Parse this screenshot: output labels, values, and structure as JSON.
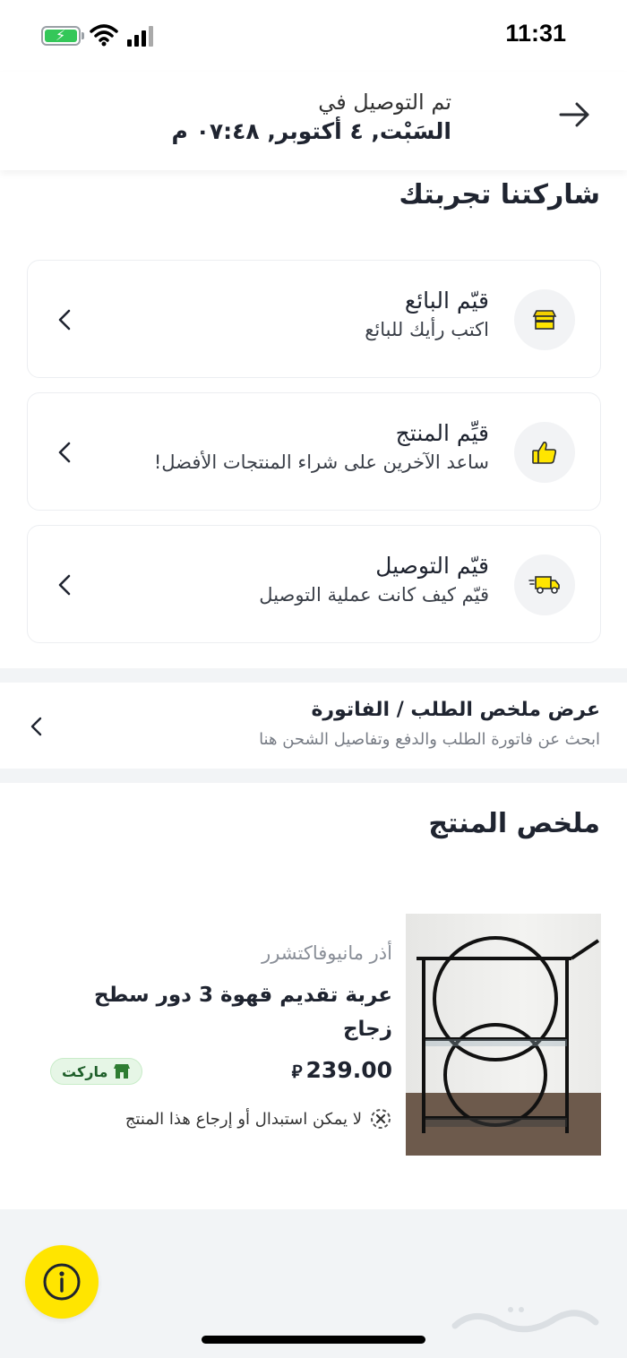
{
  "status_bar": {
    "time": "11:31"
  },
  "header": {
    "delivered_label": "تم التوصيل في",
    "delivered_date": "السَبْت, ٤ أكتوبر, ٠٧:٤٨ م"
  },
  "experience": {
    "title": "شاركتنا تجربتك",
    "cards": [
      {
        "title": "قيّم البائع",
        "subtitle": "اكتب رأيك للبائع",
        "icon": "store-icon"
      },
      {
        "title": "قيِّم المنتج",
        "subtitle": "ساعد الآخرين على شراء المنتجات الأفضل!",
        "icon": "thumbs-up-icon"
      },
      {
        "title": "قيّم التوصيل",
        "subtitle": "قيّم كيف كانت عملية التوصيل",
        "icon": "delivery-truck-icon"
      }
    ]
  },
  "invoice": {
    "title": "عرض ملخص الطلب / الفاتورة",
    "subtitle": "ابحث عن فاتورة الطلب والدفع وتفاصيل الشحن هنا"
  },
  "product_summary": {
    "title": "ملخص المنتج",
    "brand": "أذر مانيوفاكتشرر",
    "name": "عربة تقديم قهوة  3 دور سطح زجاج",
    "price": "239.00",
    "currency_symbol": "⃁",
    "badge": "ماركت",
    "return_policy": "لا يمكن استبدال أو إرجاع هذا المنتج"
  },
  "colors": {
    "accent_yellow": "#ffe500",
    "badge_green": "#e6f6e6",
    "battery_green": "#34c759"
  }
}
